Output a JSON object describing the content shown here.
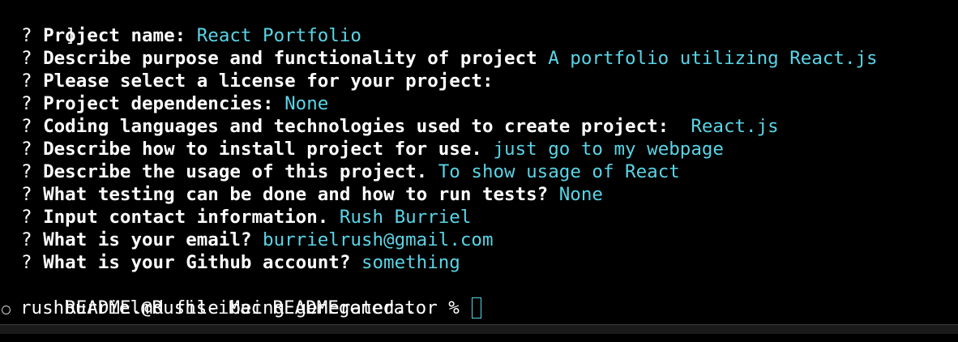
{
  "terminal": {
    "top_fragment": "]",
    "questions": [
      {
        "mark": "?",
        "question": "Project name:",
        "answer": "React Portfolio"
      },
      {
        "mark": "?",
        "question": "Describe purpose and functionality of project",
        "answer": "A portfolio utilizing React.js"
      },
      {
        "mark": "?",
        "question": "Please select a license for your project:",
        "answer": ""
      },
      {
        "mark": "?",
        "question": "Project dependencies:",
        "answer": "None"
      },
      {
        "mark": "?",
        "question": "Coding languages and technologies used to create project:",
        "answer": " React.js"
      },
      {
        "mark": "?",
        "question": "Describe how to install project for use.",
        "answer": "just go to my webpage"
      },
      {
        "mark": "?",
        "question": "Describe the usage of this project.",
        "answer": "To show usage of React"
      },
      {
        "mark": "?",
        "question": "What testing can be done and how to run tests?",
        "answer": "None"
      },
      {
        "mark": "?",
        "question": "Input contact information.",
        "answer": "Rush Burriel"
      },
      {
        "mark": "?",
        "question": "What is your email?",
        "answer": "burrielrush@gmail.com"
      },
      {
        "mark": "?",
        "question": "What is your Github account?",
        "answer": "something"
      }
    ],
    "status_message": "README.md file being generated..",
    "shell_prompt": "rushburriel@Rushs-iMac READMEgenerator %",
    "colors": {
      "background": "#000000",
      "text": "#ffffff",
      "answer": "#5ad4e6"
    }
  }
}
